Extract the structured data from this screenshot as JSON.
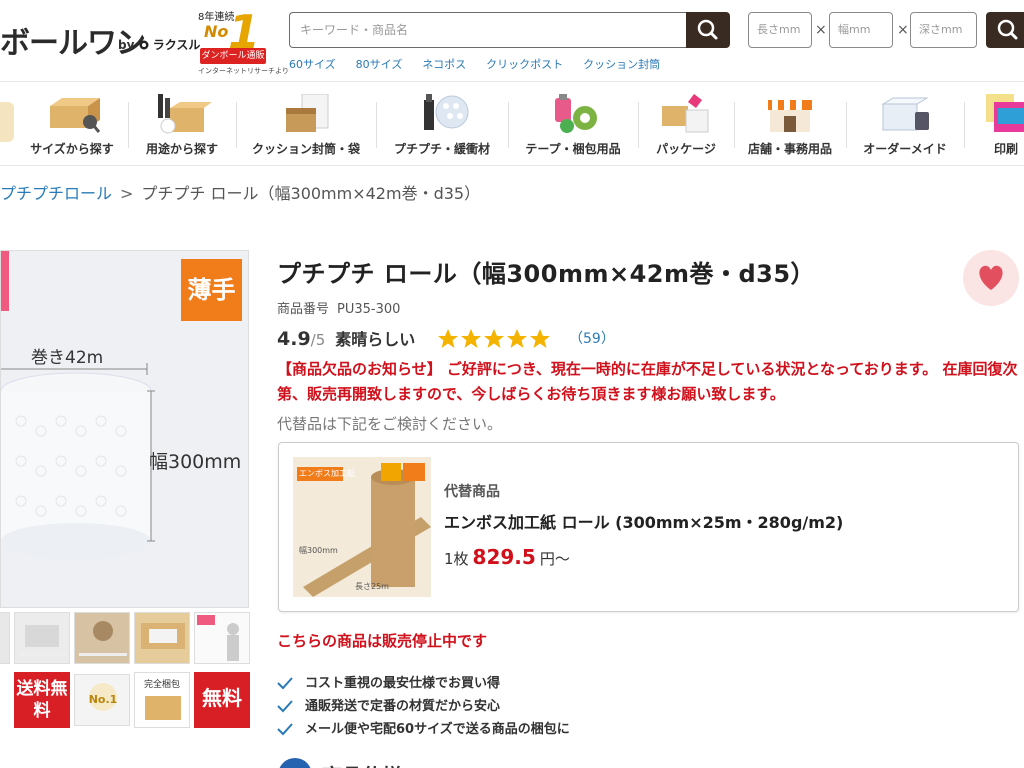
{
  "header": {
    "logo_text": "ボールワン",
    "logo_by": "by",
    "logo_brand": "ラクスル",
    "award_top": "8年連続",
    "award_no": "No",
    "award_one": "1",
    "award_ribbon": "ダンボール通販",
    "award_sub": "インターネットリサーチより",
    "search_placeholder": "キーワード・商品名",
    "size_length_placeholder": "長さmm",
    "size_width_placeholder": "幅mm",
    "size_depth_placeholder": "深さmm",
    "size_separator": "×",
    "tag_links": [
      "60サイズ",
      "80サイズ",
      "ネコポス",
      "クリックポスト",
      "クッション封筒"
    ]
  },
  "category_nav": [
    {
      "label": "サイズから探す",
      "icon": "box-ruler-icon"
    },
    {
      "label": "用途から探す",
      "icon": "wine-box-icon"
    },
    {
      "label": "クッション封筒・袋",
      "icon": "envelope-icon"
    },
    {
      "label": "プチプチ・緩衝材",
      "icon": "bubble-wrap-icon"
    },
    {
      "label": "テープ・梱包用品",
      "icon": "tape-icon"
    },
    {
      "label": "パッケージ",
      "icon": "gift-box-icon"
    },
    {
      "label": "店舗・事務用品",
      "icon": "shop-icon"
    },
    {
      "label": "オーダーメイド",
      "icon": "custom-box-icon"
    },
    {
      "label": "印刷",
      "icon": "logo-print-icon"
    }
  ],
  "breadcrumb": {
    "parent": "プチプチロール",
    "separator": ">",
    "current": "プチプチ ロール（幅300mm×42m巻・d35）"
  },
  "product_image": {
    "badge": "薄手",
    "length_label": "巻き42m",
    "width_label": "幅300mm",
    "badge_free_shipping": "送料無料",
    "badge_free": "無料",
    "badge_no1": "No.1",
    "badge_no1_title": "完全梱包"
  },
  "product": {
    "title": "プチプチ ロール（幅300mm×42m巻・d35）",
    "code_label": "商品番号",
    "code_value": "PU35-300",
    "rating_score": "4.9",
    "rating_max": "/5",
    "rating_word": "素晴らしい",
    "rating_count": "（59）",
    "stars": 5,
    "notice": "【商品欠品のお知らせ】 ご好評につき、現在一時的に在庫が不足している状況となっております。 在庫回復次第、販売再開致しますので、今しばらくお待ち頂きます様お願い致します。",
    "alt_note": "代替品は下記をご検討ください。",
    "discontinued": "こちらの商品は販売停止中です",
    "features": [
      "コスト重視の最安仕様でお買い得",
      "通販発送で定番の材質だから安心",
      "メール便や宅配60サイズで送る商品の梱包に"
    ],
    "bottom_heading": "商品仕様"
  },
  "alternative": {
    "label": "代替商品",
    "name": "エンボス加工紙 ロール (300mm×25m・280g/m2)",
    "unit": "1枚",
    "price": "829.5",
    "price_suffix": "円〜",
    "img_tag": "エンボス加工紙",
    "img_size": "幅300mm",
    "img_len": "長さ25m"
  },
  "colors": {
    "accent_red": "#d0101b",
    "link_blue": "#2a7ab8",
    "dark_brown": "#3a2b22",
    "badge_orange": "#f07c1a",
    "star_gold": "#f5b301"
  }
}
